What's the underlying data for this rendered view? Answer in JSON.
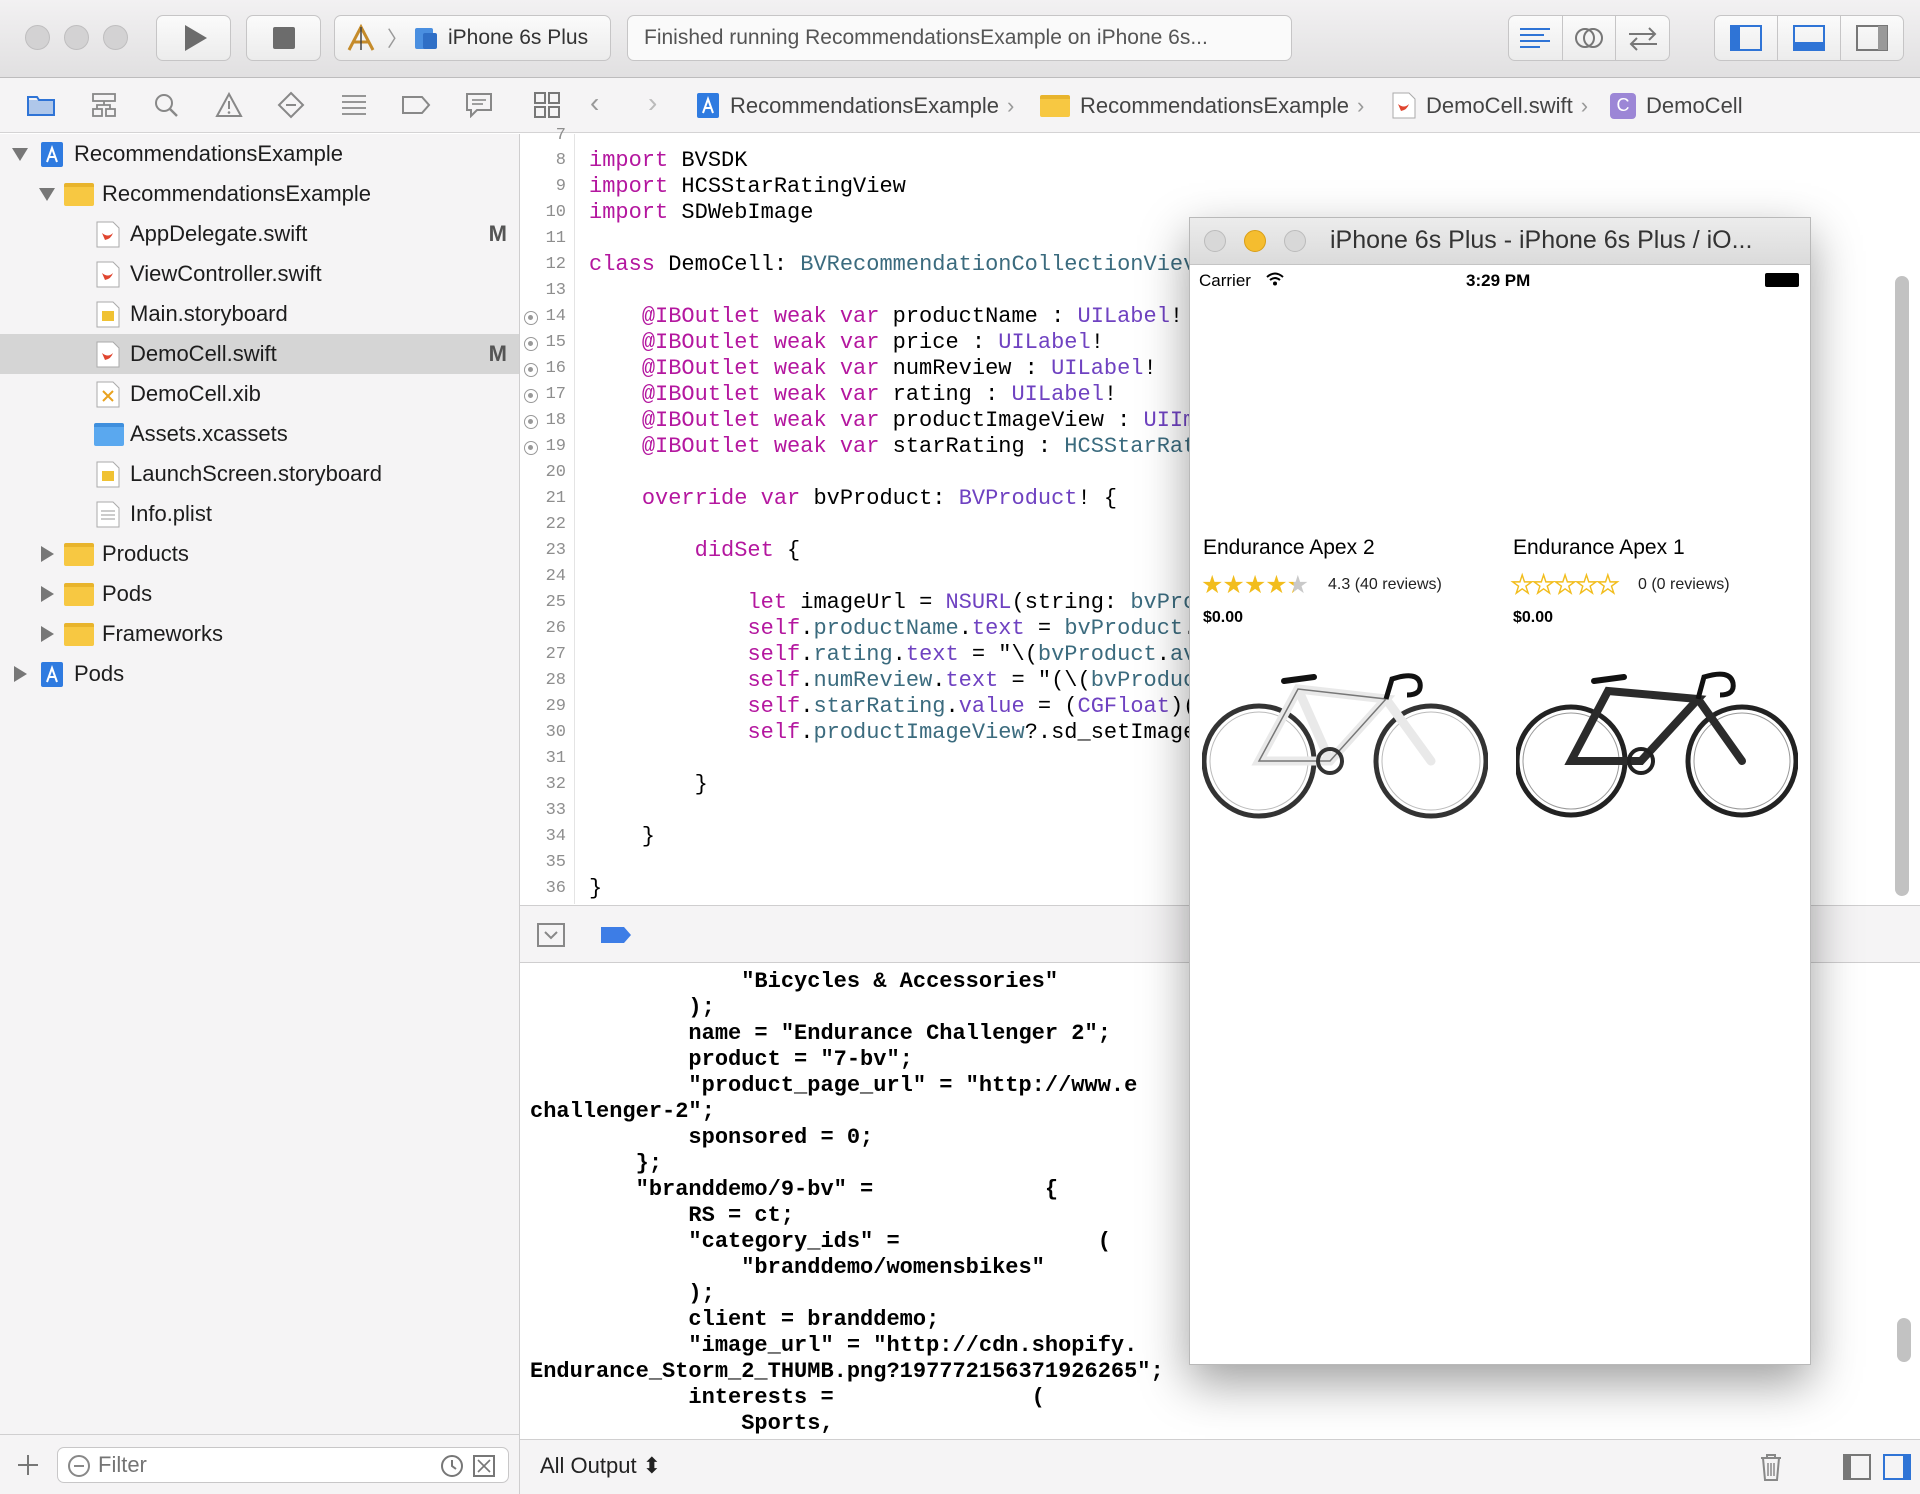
{
  "toolbar": {
    "scheme_device": "iPhone 6s Plus",
    "status_text": "Finished running RecommendationsExample on iPhone 6s..."
  },
  "jumpbar": {
    "items": [
      "RecommendationsExample",
      "RecommendationsExample",
      "DemoCell.swift",
      "DemoCell"
    ]
  },
  "navigator": {
    "items": [
      {
        "label": "RecommendationsExample",
        "mark": ""
      },
      {
        "label": "RecommendationsExample",
        "mark": ""
      },
      {
        "label": "AppDelegate.swift",
        "mark": "M"
      },
      {
        "label": "ViewController.swift",
        "mark": ""
      },
      {
        "label": "Main.storyboard",
        "mark": ""
      },
      {
        "label": "DemoCell.swift",
        "mark": "M"
      },
      {
        "label": "DemoCell.xib",
        "mark": ""
      },
      {
        "label": "Assets.xcassets",
        "mark": ""
      },
      {
        "label": "LaunchScreen.storyboard",
        "mark": ""
      },
      {
        "label": "Info.plist",
        "mark": ""
      },
      {
        "label": "Products",
        "mark": ""
      },
      {
        "label": "Pods",
        "mark": ""
      },
      {
        "label": "Frameworks",
        "mark": ""
      },
      {
        "label": "Pods",
        "mark": ""
      }
    ],
    "filter_placeholder": "Filter"
  },
  "editor": {
    "line_numbers": [
      "7",
      "8",
      "9",
      "10",
      "11",
      "12",
      "13",
      "14",
      "15",
      "16",
      "17",
      "18",
      "19",
      "20",
      "21",
      "22",
      "23",
      "24",
      "25",
      "26",
      "27",
      "28",
      "29",
      "30",
      "31",
      "32",
      "33",
      "34",
      "35",
      "36"
    ]
  },
  "console": {
    "filter_label": "All Output ⬍",
    "lines": [
      "                \"Bicycles & Accessories\"",
      "            );",
      "            name = \"Endurance Challenger 2\";",
      "            product = \"7-bv\";",
      "            \"product_page_url\" = \"http://www.e",
      "challenger-2\";",
      "            sponsored = 0;",
      "        };",
      "        \"branddemo/9-bv\" =             {",
      "            RS = ct;",
      "            \"category_ids\" =               (",
      "                \"branddemo/womensbikes\"",
      "            );",
      "            client = branddemo;",
      "            \"image_url\" = \"http://cdn.shopify.",
      "Endurance_Storm_2_THUMB.png?197772156371926265\";",
      "            interests =               (",
      "                Sports,"
    ]
  },
  "simulator": {
    "title": "iPhone 6s Plus - iPhone 6s Plus / iO...",
    "carrier": "Carrier",
    "time": "3:29 PM",
    "products": [
      {
        "name": "Endurance Apex 2",
        "rating": 4.3,
        "reviews": "4.3 (40 reviews)",
        "price": "$0.00",
        "frame_color": "#e9e9e9"
      },
      {
        "name": "Endurance Apex 1",
        "rating": 0,
        "reviews": "0 (0 reviews)",
        "price": "$0.00",
        "frame_color": "#2b2b2b"
      }
    ]
  },
  "colors": {
    "keyword": "#b4179f",
    "type": "#6f42c1",
    "class": "#3b6b7e",
    "star": "#f2bd1d",
    "accent": "#3d7de6"
  }
}
